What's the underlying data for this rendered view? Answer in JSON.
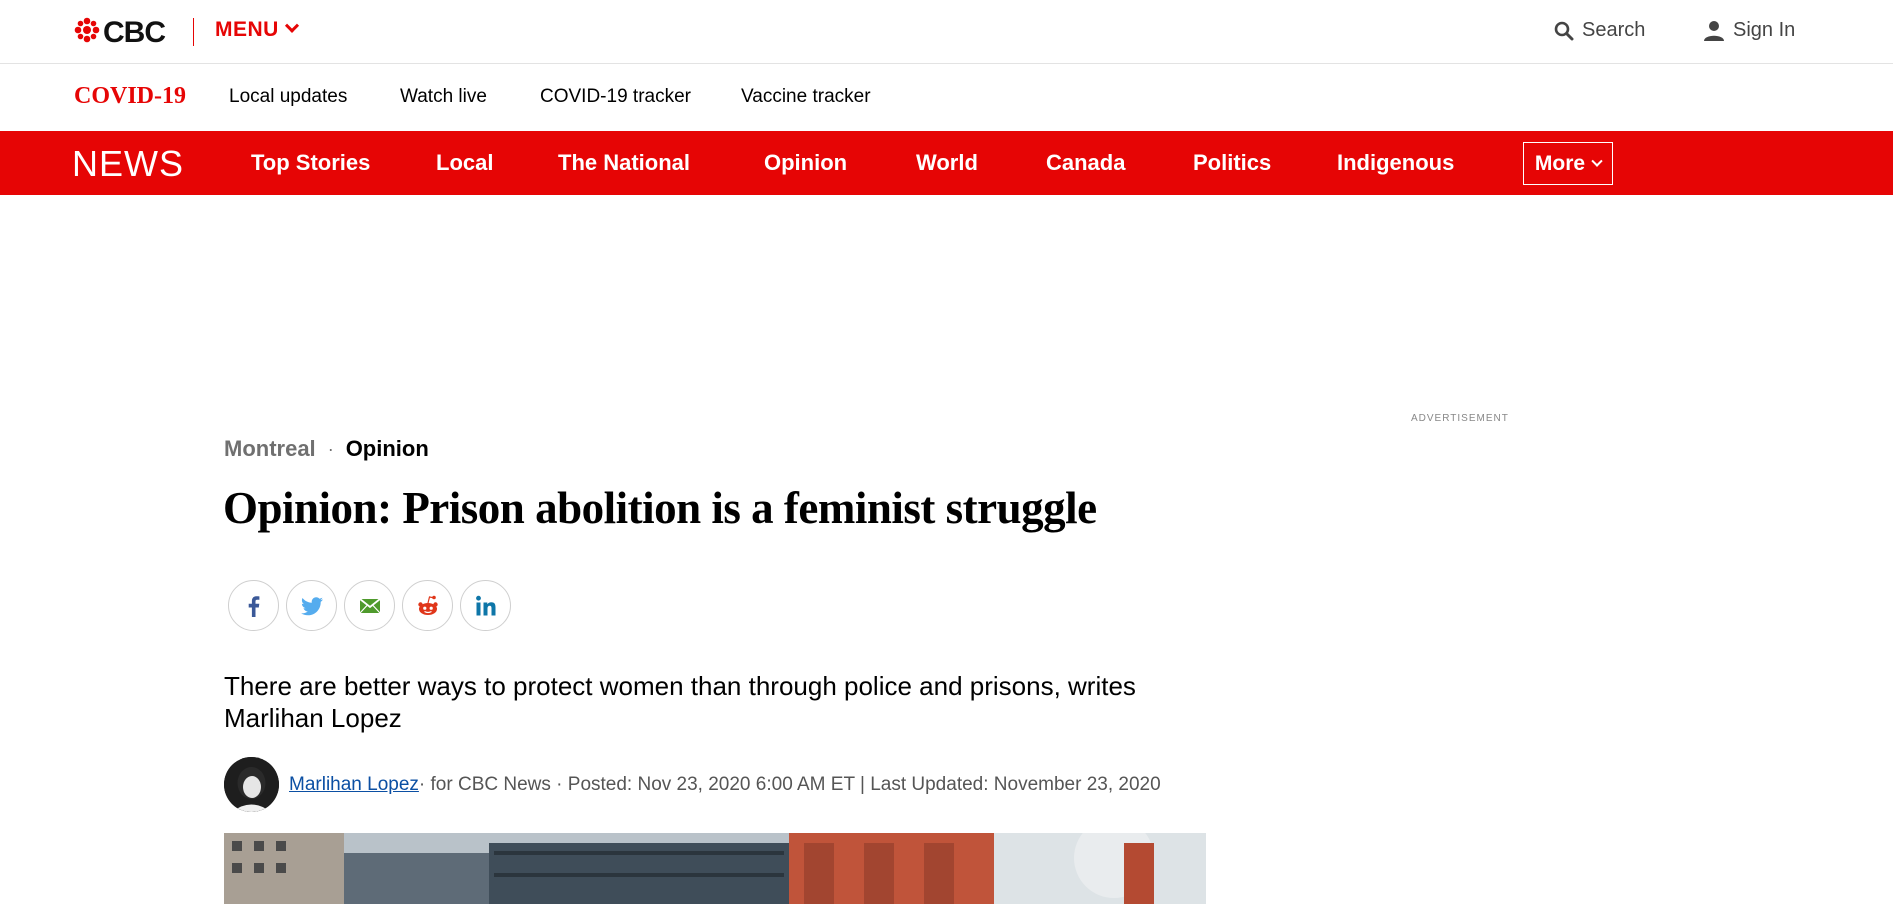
{
  "brand": {
    "logo_text": "CBC",
    "accent_color": "#e60505",
    "logo_icon": "cbc-gem-icon"
  },
  "header": {
    "menu_label": "MENU",
    "search_label": "Search",
    "signin_label": "Sign In"
  },
  "covid_bar": {
    "title": "COVID-19",
    "links": [
      "Local updates",
      "Watch live",
      "COVID-19 tracker",
      "Vaccine tracker"
    ]
  },
  "news_nav": {
    "logo": "NEWS",
    "items": [
      "Top Stories",
      "Local",
      "The National",
      "Opinion",
      "World",
      "Canada",
      "Politics",
      "Indigenous"
    ],
    "more_label": "More"
  },
  "ad": {
    "label": "ADVERTISEMENT"
  },
  "article": {
    "section": "Montreal",
    "category": "Opinion",
    "headline": "Opinion: Prison abolition is a feminist struggle",
    "share_icons": [
      "facebook-icon",
      "twitter-icon",
      "email-icon",
      "reddit-icon",
      "linkedin-icon"
    ],
    "deck": "There are better ways to protect women than through police and prisons, writes Marlihan Lopez",
    "byline": {
      "author": "Marlihan Lopez",
      "meta": " · for CBC News · Posted: Nov 23, 2020 6:00 AM ET | Last Updated: November 23, 2020"
    }
  }
}
